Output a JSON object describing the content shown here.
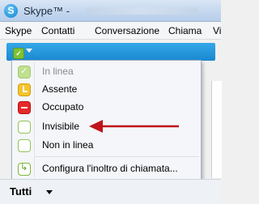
{
  "window": {
    "title": "Skype™ -"
  },
  "menubar": {
    "items": [
      "Skype",
      "Contatti",
      "Conversazione",
      "Chiama",
      "Vi"
    ]
  },
  "status_menu": {
    "items": [
      {
        "label": "In linea",
        "icon": "online-icon",
        "disabled": true
      },
      {
        "label": "Assente",
        "icon": "away-icon"
      },
      {
        "label": "Occupato",
        "icon": "busy-icon"
      },
      {
        "label": "Invisibile",
        "icon": "invisible-icon",
        "highlighted_by_arrow": true
      },
      {
        "label": "Non in linea",
        "icon": "offline-icon"
      },
      {
        "label": "Configura l'inoltro di chiamata...",
        "icon": "call-forward-icon"
      }
    ]
  },
  "contacts_filter": {
    "label": "Tutti"
  },
  "colors": {
    "accent": "#1b88d1",
    "arrow": "#c0141c",
    "online": "#7ec234",
    "busy": "#e52a2a",
    "away": "#f3c431"
  }
}
